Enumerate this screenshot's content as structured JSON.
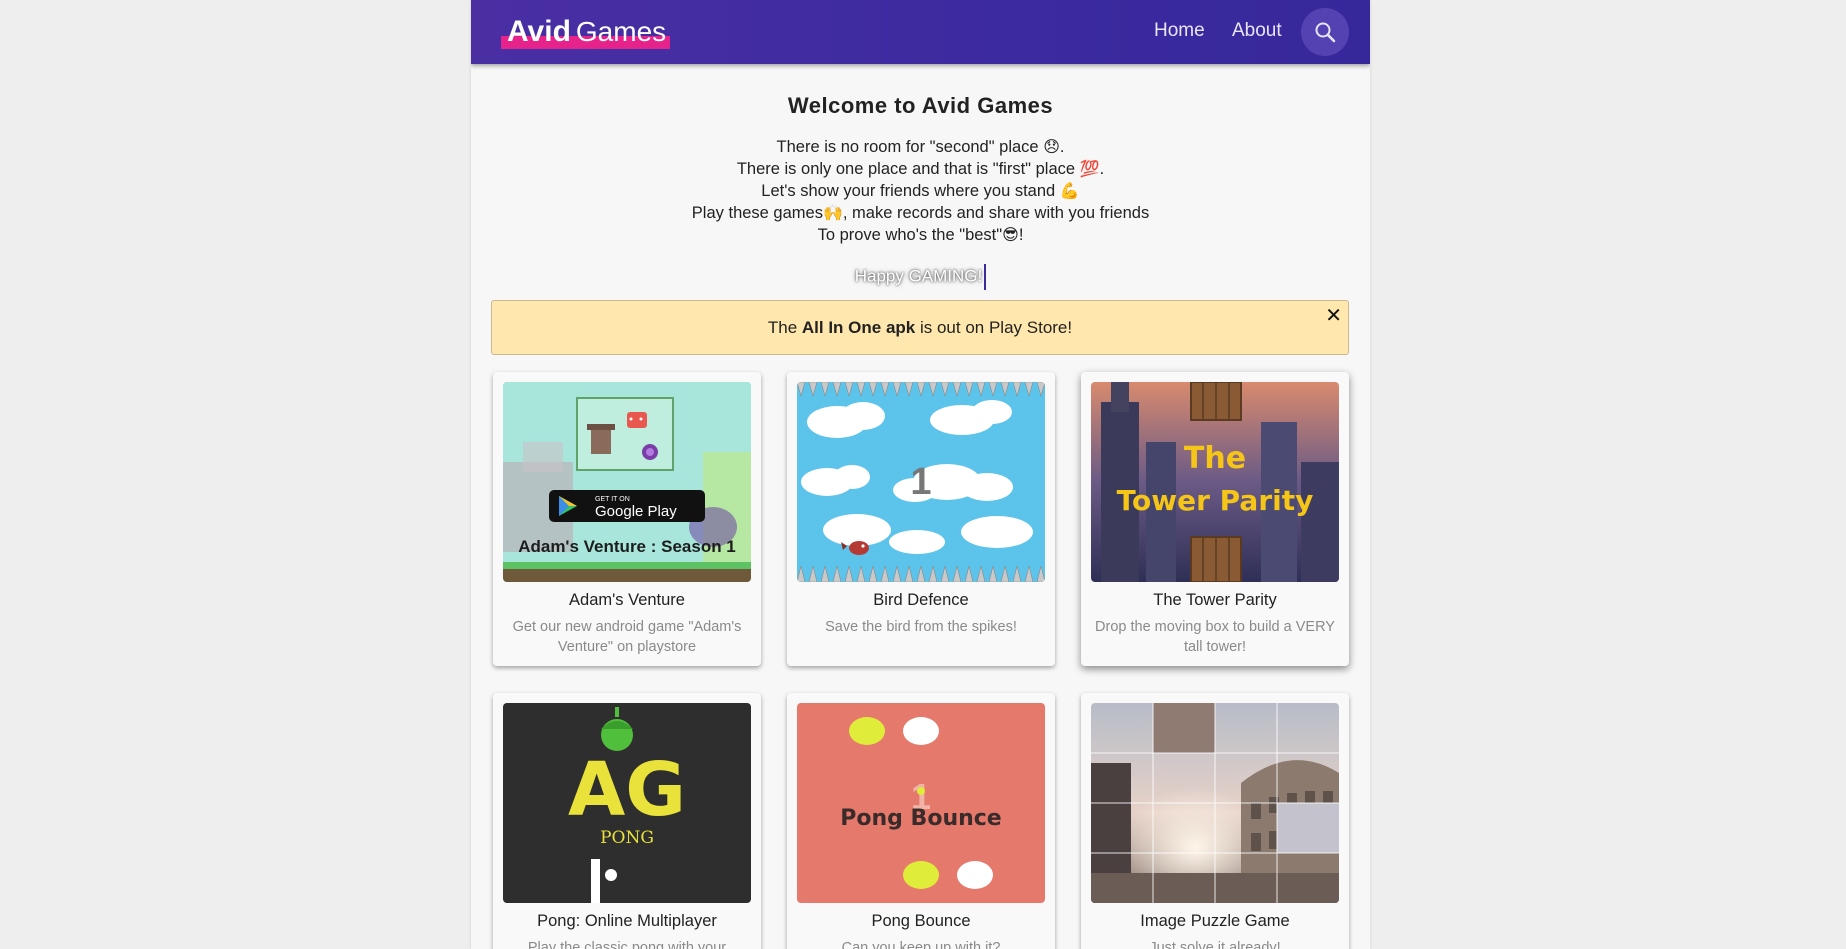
{
  "header": {
    "logo_strong": "Avid",
    "logo_light": "Games",
    "nav": [
      "Home",
      "About"
    ],
    "search_icon": "search-icon"
  },
  "welcome_title": "Welcome to Avid Games",
  "intro": [
    {
      "text": "There is no room for \"second\" place ",
      "emoji": "😞",
      "after": "."
    },
    {
      "text": "There is only one place and that is \"first\" place ",
      "emoji": "💯",
      "after": "."
    },
    {
      "text": "Let's show your friends where you stand ",
      "emoji": "💪",
      "after": ""
    },
    {
      "text": "Play these games",
      "emoji": "🙌",
      "after": ", make records and share with you friends"
    },
    {
      "text": "To prove who's the \"best\"",
      "emoji": "😎",
      "after": "!"
    }
  ],
  "happy_text": "Happy GAMING!",
  "banner": {
    "prefix": "The ",
    "bold": "All In One apk",
    "suffix": " is out on Play Store!",
    "close": "✕"
  },
  "games": [
    {
      "title": "Adam's Venture",
      "desc": "Get our new android game \"Adam's Venture\" on playstore",
      "art": {
        "caption": "Adam's Venture : Season 1",
        "badge_small": "GET IT ON",
        "badge_big": "Google Play"
      }
    },
    {
      "title": "Bird Defence",
      "desc": "Save the bird from the spikes!",
      "art": {
        "score": "1"
      }
    },
    {
      "title": "The Tower Parity",
      "desc": "Drop the moving box to build a VERY tall tower!",
      "art": {
        "line1": "The",
        "line2": "Tower Parity"
      }
    },
    {
      "title": "Pong: Online Multiplayer",
      "desc": "Play the classic pong with your",
      "art": {
        "logo": "AG",
        "sub": "PONG"
      }
    },
    {
      "title": "Pong Bounce",
      "desc": "Can you keep up with it?",
      "art": {
        "score": "1",
        "label": "Pong Bounce"
      }
    },
    {
      "title": "Image Puzzle Game",
      "desc": "Just solve it already!",
      "art": {}
    }
  ],
  "colors": {
    "navbar": "#3f2ba0",
    "logo_accent": "#e6238b",
    "banner_bg": "#ffe7ad",
    "tower_text": "#f5c518",
    "pong_bounce_bg": "#e57a6c"
  }
}
